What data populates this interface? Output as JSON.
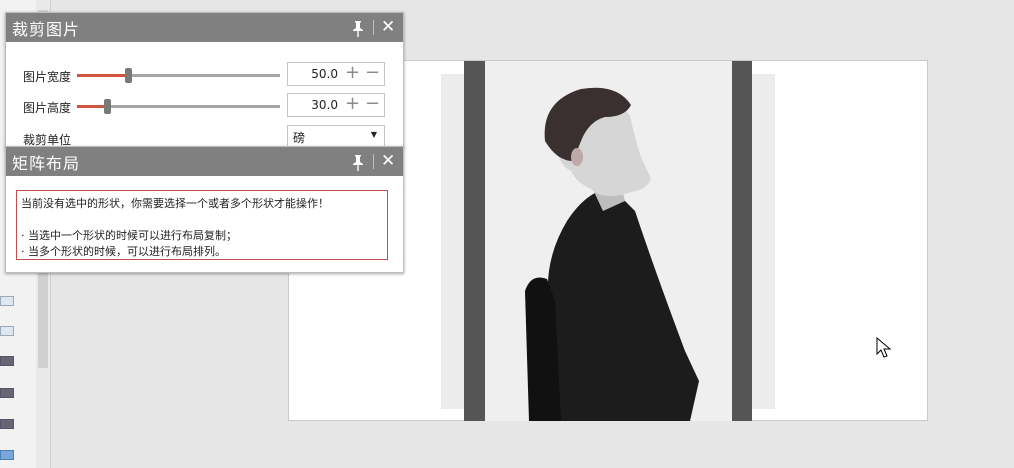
{
  "crop_panel": {
    "title": "裁剪图片",
    "width_label": "图片宽度",
    "width_value": "50.0",
    "height_label": "图片高度",
    "height_value": "30.0",
    "unit_label": "裁剪单位",
    "unit_value": "磅",
    "plus": "+",
    "minus": "−",
    "close": "✕",
    "width_slider_fraction": 0.25,
    "height_slider_fraction": 0.15
  },
  "matrix_panel": {
    "title": "矩阵布局",
    "close": "✕",
    "notice_line1": "当前没有选中的形状，你需要选择一个或者多个形状才能操作！",
    "notice_line2": "· 当选中一个形状的时候可以进行布局复制；",
    "notice_line3": "· 当多个形状的时候，可以进行布局排列。"
  },
  "colors": {
    "header": "#808080",
    "slider_fill": "#d0553c",
    "notice_border": "#c0504d"
  },
  "icons": [
    "pin-icon",
    "close-icon",
    "plus-icon",
    "minus-icon",
    "dropdown-arrow-icon",
    "mouse-cursor-icon"
  ]
}
